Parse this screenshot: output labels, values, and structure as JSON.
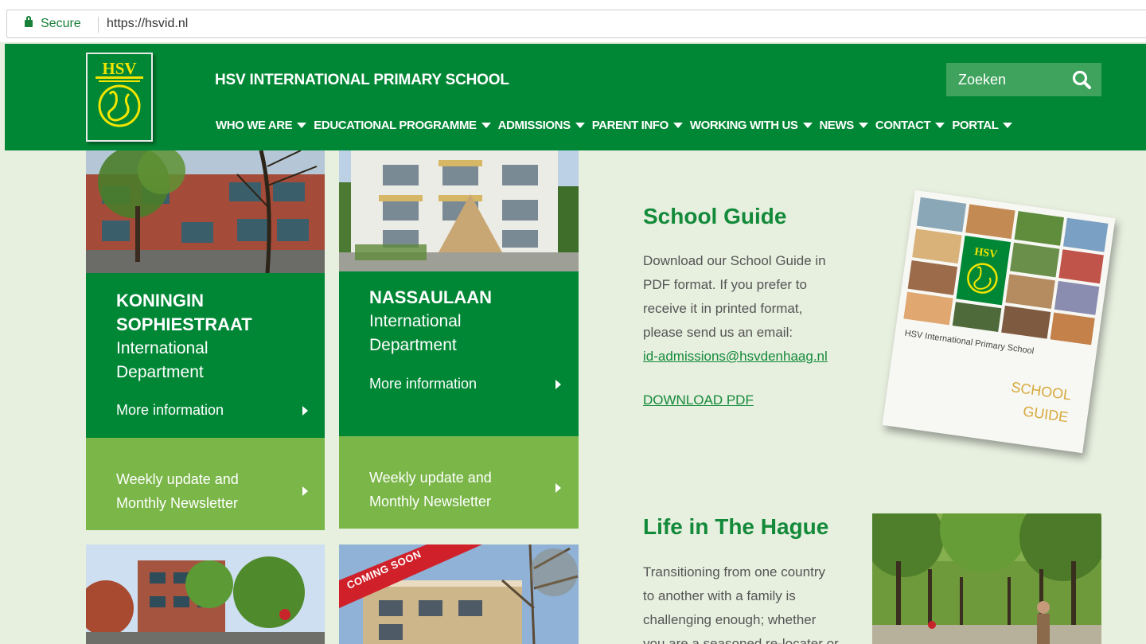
{
  "browser": {
    "secure_label": "Secure",
    "url": "https://hsvid.nl"
  },
  "header": {
    "logo_text": "HSV",
    "site_title": "HSV INTERNATIONAL PRIMARY SCHOOL",
    "search_placeholder": "Zoeken",
    "nav": [
      "WHO WE ARE",
      "EDUCATIONAL PROGRAMME",
      "ADMISSIONS",
      "PARENT INFO",
      "WORKING WITH US",
      "NEWS",
      "CONTACT",
      "PORTAL"
    ]
  },
  "cards": [
    {
      "name_line1": "KONINGIN",
      "name_line2": "SOPHIESTRAAT",
      "sub_line1": "International",
      "sub_line2": "Department",
      "more_info": "More information",
      "weekly_line1": "Weekly update and",
      "weekly_line2": "Monthly Newsletter"
    },
    {
      "name_line1": "NASSAULAAN",
      "sub_line1": "International",
      "sub_line2": "Department",
      "more_info": "More information",
      "weekly_line1": "Weekly update and",
      "weekly_line2": "Monthly Newsletter"
    }
  ],
  "coming_soon_label": "COMING SOON",
  "school_guide": {
    "title": "School Guide",
    "text_lines": [
      "Download our School Guide in",
      "PDF format. If you prefer to",
      "receive it in printed format,",
      "please send us an email:"
    ],
    "email": "id-admissions@hsvdenhaag.nl",
    "download_label": "DOWNLOAD PDF",
    "brochure_caption": "HSV International Primary School",
    "brochure_title_line1": "SCHOOL",
    "brochure_title_line2": "GUIDE",
    "brochure_logo": "HSV"
  },
  "life_hague": {
    "title": "Life in The Hague",
    "text_lines": [
      "Transitioning from one country",
      "to another with a family is",
      "challenging enough; whether",
      "you are a seasoned re-locater or"
    ]
  },
  "colors": {
    "header_green": "#008735",
    "lime": "#7ab648",
    "page_bg": "#e7efdf",
    "logo_yellow": "#f2e500"
  }
}
